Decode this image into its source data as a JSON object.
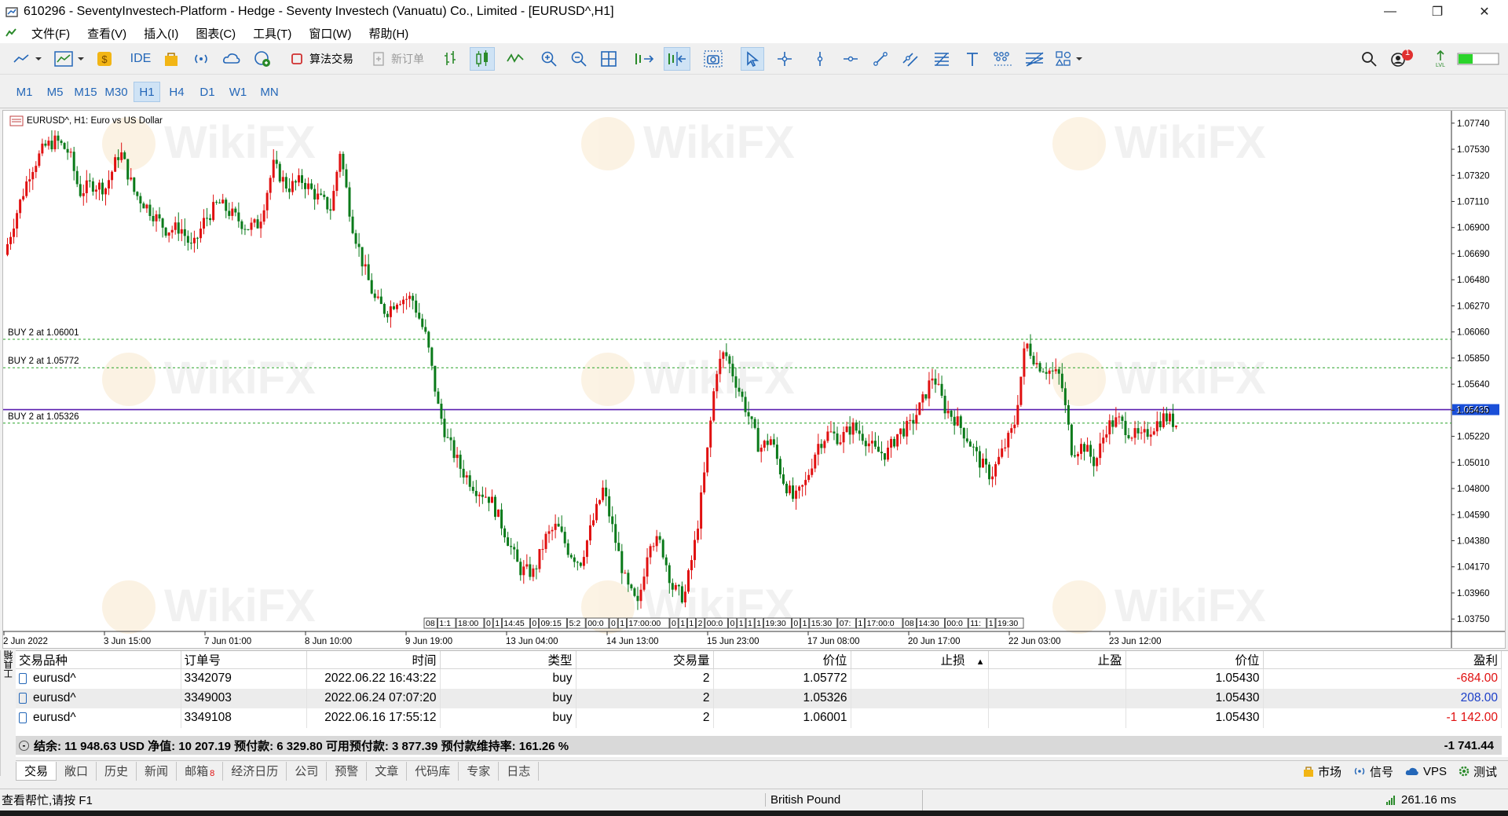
{
  "window": {
    "title": "610296 - SeventyInvestech-Platform - Hedge - Seventy Investech (Vanuatu) Co., Limited - [EURUSD^,H1]"
  },
  "menu": [
    "文件(F)",
    "查看(V)",
    "插入(I)",
    "图表(C)",
    "工具(T)",
    "窗口(W)",
    "帮助(H)"
  ],
  "toolbar": {
    "ide_label": "IDE",
    "algo_label": "算法交易",
    "new_order_label": "新订单",
    "notification_count": "1"
  },
  "timeframes": [
    "M1",
    "M5",
    "M15",
    "M30",
    "H1",
    "H4",
    "D1",
    "W1",
    "MN"
  ],
  "active_timeframe": "H1",
  "chart": {
    "symbol_label": "EURUSD^, H1:  Euro vs US Dollar",
    "watermark": "WikiFX",
    "current_price": "1.05435",
    "price_labels": [
      "1.07740",
      "1.07530",
      "1.07320",
      "1.07110",
      "1.06900",
      "1.06690",
      "1.06480",
      "1.06270",
      "1.06060",
      "1.05850",
      "1.05640",
      "1.05430",
      "1.05220",
      "1.05010",
      "1.04800",
      "1.04590",
      "1.04380",
      "1.04170",
      "1.03960",
      "1.03750"
    ],
    "time_labels": [
      "2 Jun 2022",
      "3 Jun 15:00",
      "7 Jun 01:00",
      "8 Jun 10:00",
      "9 Jun 19:00",
      "13 Jun 04:00",
      "14 Jun 13:00",
      "15 Jun 23:00",
      "17 Jun 08:00",
      "20 Jun 17:00",
      "22 Jun 03:00",
      "23 Jun 12:00"
    ],
    "order_lines": [
      {
        "label": "BUY 2 at 1.06001",
        "price": 1.06001
      },
      {
        "label": "BUY 2 at 1.05772",
        "price": 1.05772
      },
      {
        "label": "BUY 2 at 1.05326",
        "price": 1.05326
      }
    ],
    "event_markers": [
      "08",
      "1:1",
      "18:00",
      "0",
      "1",
      "14:45",
      "0",
      "09:15",
      "5:2",
      "00:0",
      "0",
      "1",
      "17:00:00",
      "0",
      "1",
      "1",
      "2",
      "00:0",
      "0",
      "1",
      "1",
      "1",
      "19:30",
      "0",
      "1",
      "15:30",
      "07:",
      "1",
      "17:00:0",
      "08",
      "14:30",
      "00:0",
      "11:",
      "1",
      "19:30"
    ]
  },
  "chart_data": {
    "type": "candlestick",
    "symbol": "EURUSD^",
    "timeframe": "H1",
    "x_range": [
      "2 Jun 2022",
      "24 Jun 2022"
    ],
    "ylim": [
      1.0365,
      1.0784
    ],
    "y_ticks": [
      1.0774,
      1.0753,
      1.0732,
      1.0711,
      1.069,
      1.0669,
      1.0648,
      1.0627,
      1.0606,
      1.0585,
      1.0564,
      1.0543,
      1.0522,
      1.0501,
      1.048,
      1.0459,
      1.0438,
      1.0417,
      1.0396,
      1.0375
    ],
    "path_points": [
      [
        0,
        1.0668
      ],
      [
        8,
        1.07
      ],
      [
        18,
        1.0736
      ],
      [
        28,
        1.0755
      ],
      [
        36,
        1.076
      ],
      [
        45,
        1.075
      ],
      [
        52,
        1.0718
      ],
      [
        60,
        1.0725
      ],
      [
        70,
        1.0722
      ],
      [
        80,
        1.0752
      ],
      [
        90,
        1.0718
      ],
      [
        100,
        1.0705
      ],
      [
        112,
        1.0688
      ],
      [
        122,
        1.069
      ],
      [
        130,
        1.0672
      ],
      [
        138,
        1.0695
      ],
      [
        148,
        1.071
      ],
      [
        158,
        1.07
      ],
      [
        168,
        1.069
      ],
      [
        176,
        1.0693
      ],
      [
        186,
        1.074
      ],
      [
        196,
        1.0722
      ],
      [
        206,
        1.0728
      ],
      [
        216,
        1.0715
      ],
      [
        226,
        1.0705
      ],
      [
        232,
        1.0752
      ],
      [
        240,
        1.0695
      ],
      [
        248,
        1.066
      ],
      [
        256,
        1.0632
      ],
      [
        264,
        1.0622
      ],
      [
        272,
        1.0633
      ],
      [
        282,
        1.0633
      ],
      [
        292,
        1.06
      ],
      [
        300,
        1.0545
      ],
      [
        306,
        1.052
      ],
      [
        316,
        1.0495
      ],
      [
        326,
        1.048
      ],
      [
        336,
        1.0472
      ],
      [
        346,
        1.0445
      ],
      [
        356,
        1.0415
      ],
      [
        366,
        1.0412
      ],
      [
        374,
        1.044
      ],
      [
        382,
        1.045
      ],
      [
        390,
        1.043
      ],
      [
        398,
        1.042
      ],
      [
        406,
        1.045
      ],
      [
        414,
        1.048
      ],
      [
        422,
        1.044
      ],
      [
        430,
        1.0402
      ],
      [
        438,
        1.0385
      ],
      [
        446,
        1.044
      ],
      [
        454,
        1.0435
      ],
      [
        462,
        1.04
      ],
      [
        470,
        1.0392
      ],
      [
        478,
        1.044
      ],
      [
        486,
        1.051
      ],
      [
        492,
        1.0575
      ],
      [
        498,
        1.059
      ],
      [
        506,
        1.0565
      ],
      [
        514,
        1.054
      ],
      [
        522,
        1.0512
      ],
      [
        530,
        1.052
      ],
      [
        538,
        1.0488
      ],
      [
        546,
        1.047
      ],
      [
        554,
        1.0485
      ],
      [
        562,
        1.0515
      ],
      [
        570,
        1.0525
      ],
      [
        578,
        1.052
      ],
      [
        586,
        1.053
      ],
      [
        594,
        1.0522
      ],
      [
        602,
        1.051
      ],
      [
        610,
        1.0508
      ],
      [
        618,
        1.0525
      ],
      [
        626,
        1.053
      ],
      [
        634,
        1.0548
      ],
      [
        642,
        1.0572
      ],
      [
        650,
        1.0545
      ],
      [
        658,
        1.0535
      ],
      [
        666,
        1.052
      ],
      [
        674,
        1.0502
      ],
      [
        682,
        1.049
      ],
      [
        690,
        1.051
      ],
      [
        698,
        1.053
      ],
      [
        706,
        1.0598
      ],
      [
        714,
        1.058
      ],
      [
        722,
        1.0575
      ],
      [
        730,
        1.057
      ],
      [
        738,
        1.051
      ],
      [
        746,
        1.0515
      ],
      [
        754,
        1.05
      ],
      [
        762,
        1.053
      ],
      [
        770,
        1.0535
      ],
      [
        778,
        1.0525
      ],
      [
        786,
        1.052
      ],
      [
        794,
        1.053
      ],
      [
        802,
        1.0538
      ],
      [
        810,
        1.0532
      ]
    ]
  },
  "trades": {
    "headers": [
      "交易品种",
      "订单号",
      "时间",
      "类型",
      "交易量",
      "价位",
      "止损",
      "止盈",
      "价位",
      "盈利"
    ],
    "rows": [
      {
        "symbol": "eurusd^",
        "order": "3342079",
        "time": "2022.06.22 16:43:22",
        "type": "buy",
        "volume": "2",
        "price": "1.05772",
        "sl": "",
        "tp": "",
        "cur": "1.05430",
        "profit": "-684.00"
      },
      {
        "symbol": "eurusd^",
        "order": "3349003",
        "time": "2022.06.24 07:07:20",
        "type": "buy",
        "volume": "2",
        "price": "1.05326",
        "sl": "",
        "tp": "",
        "cur": "1.05430",
        "profit": "208.00"
      },
      {
        "symbol": "eurusd^",
        "order": "3349108",
        "time": "2022.06.16 17:55:12",
        "type": "buy",
        "volume": "2",
        "price": "1.06001",
        "sl": "",
        "tp": "",
        "cur": "1.05430",
        "profit": "-1 142.00"
      }
    ],
    "summary": "结余: 11 948.63 USD  净值: 10 207.19  预付款: 6 329.80  可用预付款: 3 877.39  预付款维持率: 161.26 %",
    "total_profit": "-1 741.44"
  },
  "panel_label": "工具箱",
  "bottom_tabs": [
    "交易",
    "敞口",
    "历史",
    "新闻",
    "邮箱",
    "经济日历",
    "公司",
    "预警",
    "文章",
    "代码库",
    "专家",
    "日志"
  ],
  "mail_badge": "8",
  "right_tabs": [
    "市场",
    "信号",
    "VPS",
    "测试"
  ],
  "status": {
    "help": "查看帮忙,请按 F1",
    "profile": "British Pound",
    "ping": "261.16 ms"
  },
  "colors": {
    "bull": "#e01010",
    "bear": "#0a7a1a",
    "price_line": "#5a1fb0",
    "order_line": "#28a428",
    "accent": "#2467b8"
  }
}
